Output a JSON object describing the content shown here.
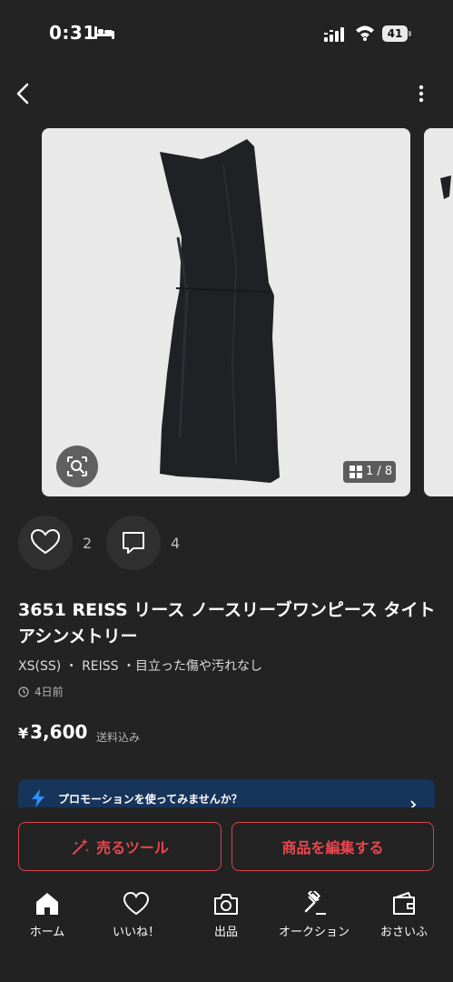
{
  "status_bar": {
    "time": "0:31",
    "battery": "41"
  },
  "product": {
    "photo_counter": "1 / 8",
    "likes_count": "2",
    "comments_count": "4",
    "title": "3651 REISS リース ノースリーブワンピース タイト アシンメトリー",
    "meta": "XS(SS) ・ REISS ・目立った傷や汚れなし",
    "posted": "4日前",
    "price_symbol": "¥",
    "price": "3,600",
    "price_note": "送料込み"
  },
  "promo": {
    "text": "プロモーションを使ってみませんか？",
    "color": "#17345a"
  },
  "actions": {
    "sell_tool": "売るツール",
    "edit": "商品を編集する",
    "accent": "#e8474f"
  },
  "tabs": [
    {
      "label": "ホーム",
      "icon": "home-icon"
    },
    {
      "label": "いいね！",
      "icon": "heart-icon"
    },
    {
      "label": "出品",
      "icon": "camera-icon"
    },
    {
      "label": "オークション",
      "icon": "gavel-icon"
    },
    {
      "label": "おさいふ",
      "icon": "wallet-icon"
    }
  ]
}
